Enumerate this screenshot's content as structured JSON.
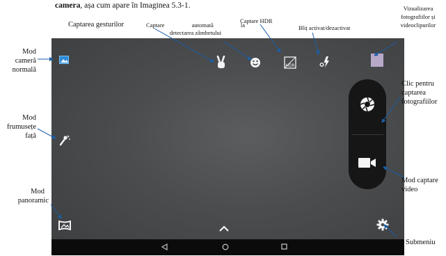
{
  "intro": {
    "bold": "camera",
    "rest": ", așa cum apare în Imaginea 5.3-1."
  },
  "labels": {
    "gestures": "Captarea gesturilor",
    "smile_1": "Captare automată la",
    "smile_2": "detectarea zâmbetului",
    "hdr": "Captare HDR",
    "flash": "Bliț activat/dezactivat",
    "viz_1": "Vizualizarea",
    "viz_2": "fotografiilor și",
    "viz_3": "videoclipurilor",
    "normal_1": "Mod",
    "normal_2": "cameră",
    "normal_3": "normală",
    "beauty_1": "Mod",
    "beauty_2": "frumusețe",
    "beauty_3": "față",
    "pano_1": "Mod",
    "pano_2": "panoramic",
    "shutter_1": "Clic pentru",
    "shutter_2": "captarea",
    "shutter_3": "fotografiilor",
    "video_1": "Mod captare",
    "video_2": "video",
    "submenu": "Submeniu"
  },
  "icons": {
    "normal_mode": "image-icon",
    "beauty_mode": "magic-wand-icon",
    "panorama_mode": "panorama-icon",
    "gesture": "victory-hand-icon",
    "smile": "smiley-face-icon",
    "hdr": "hdr-icon",
    "flash": "flash-auto-icon",
    "gallery": "gallery-thumbnail",
    "shutter": "camera-aperture-icon",
    "video": "video-camera-icon",
    "settings": "gear-icon",
    "expand": "chevron-up-icon",
    "back": "back-triangle-icon",
    "home": "home-circle-icon",
    "recents": "recents-square-icon"
  },
  "icon_glyphs": {
    "hdr_text": "HDR"
  },
  "colors": {
    "viewfinder": "#4a4c4e",
    "navbar": "#0b0b0b",
    "shutter_panel": "#161616",
    "icon": "#f4f4f4",
    "accent_blue": "#2e8bd8",
    "gallery_thumb": "#b9a9c9"
  }
}
